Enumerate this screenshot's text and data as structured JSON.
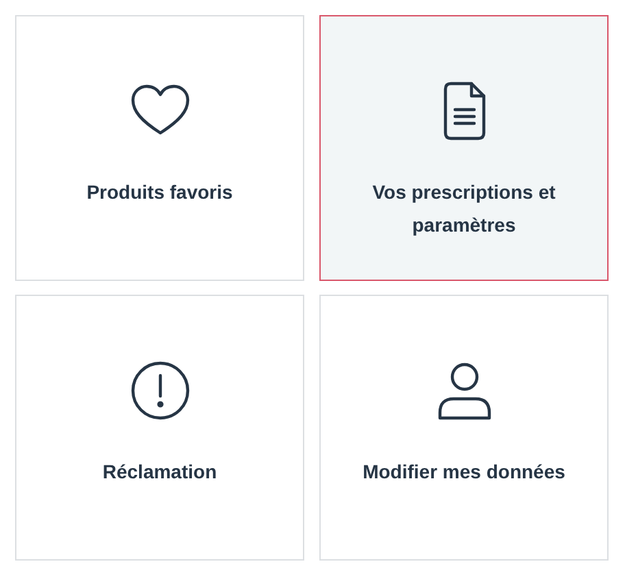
{
  "tiles": [
    {
      "kind": "heart",
      "label": "Produits favoris",
      "selected": false
    },
    {
      "kind": "document",
      "label": "Vos prescriptions et paramètres",
      "selected": true
    },
    {
      "kind": "alert",
      "label": "Réclamation",
      "selected": false
    },
    {
      "kind": "person",
      "label": "Modifier mes données",
      "selected": false
    }
  ]
}
